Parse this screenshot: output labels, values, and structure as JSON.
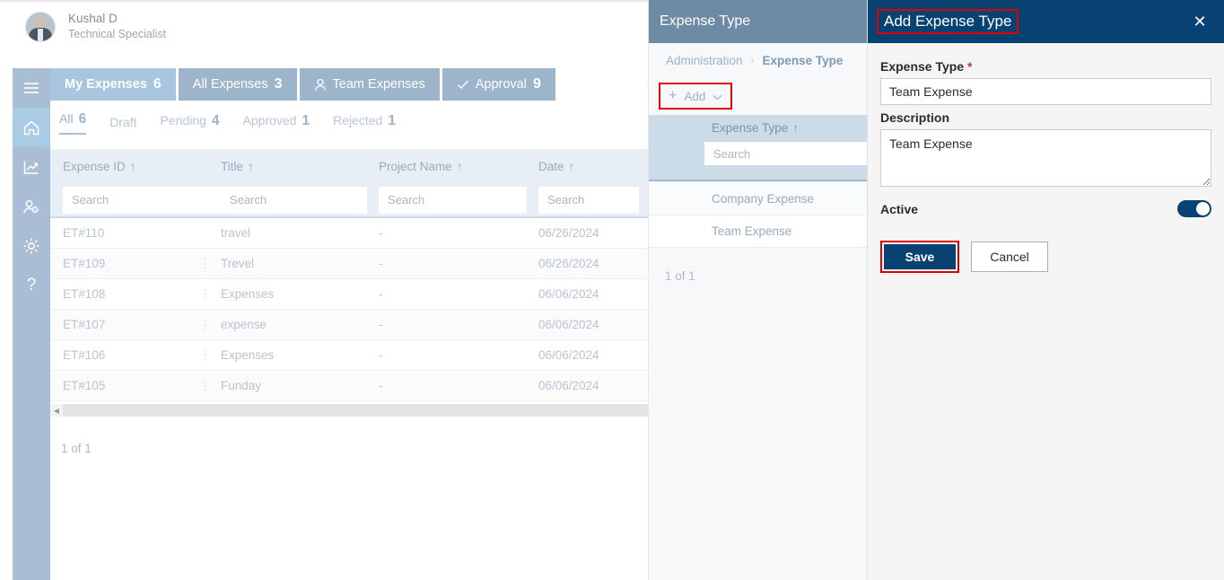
{
  "user": {
    "name": "Kushal D",
    "role": "Technical Specialist"
  },
  "rail": {
    "items": [
      {
        "name": "menu",
        "icon": "hamburger-icon"
      },
      {
        "name": "home",
        "icon": "home-icon"
      },
      {
        "name": "analytics",
        "icon": "chart-line-icon"
      },
      {
        "name": "user-settings",
        "icon": "user-gear-icon"
      },
      {
        "name": "settings",
        "icon": "gear-icon"
      },
      {
        "name": "help",
        "icon": "question-mark-icon"
      }
    ]
  },
  "tabs": [
    {
      "label": "My Expenses",
      "count": "6",
      "icon": "",
      "active": true
    },
    {
      "label": "All Expenses",
      "count": "3",
      "icon": "",
      "active": false
    },
    {
      "label": "Team Expenses",
      "count": "",
      "icon": "person-icon",
      "active": false
    },
    {
      "label": "Approval",
      "count": "9",
      "icon": "check-icon",
      "active": false
    }
  ],
  "subtabs": [
    {
      "label": "All",
      "count": "6",
      "active": true
    },
    {
      "label": "Draft",
      "count": "",
      "active": false
    },
    {
      "label": "Pending",
      "count": "4",
      "active": false
    },
    {
      "label": "Approved",
      "count": "1",
      "active": false
    },
    {
      "label": "Rejected",
      "count": "1",
      "active": false
    }
  ],
  "table": {
    "headers": [
      "Expense ID",
      "Title",
      "Project Name",
      "Date"
    ],
    "sort_glyph": "↑",
    "search_placeholder": "Search",
    "search_values": [
      "",
      "",
      "",
      ""
    ],
    "rows": [
      {
        "id": "ET#110",
        "kebab": "",
        "title": "travel",
        "project": "-",
        "date": "06/26/2024"
      },
      {
        "id": "ET#109",
        "kebab": "⋮",
        "title": "Trevel",
        "project": "-",
        "date": "06/26/2024"
      },
      {
        "id": "ET#108",
        "kebab": "⋮",
        "title": "Expenses",
        "project": "-",
        "date": "06/06/2024"
      },
      {
        "id": "ET#107",
        "kebab": "⋮",
        "title": "expense",
        "project": "-",
        "date": "06/06/2024"
      },
      {
        "id": "ET#106",
        "kebab": "⋮",
        "title": "Expenses",
        "project": "-",
        "date": "06/06/2024"
      },
      {
        "id": "ET#105",
        "kebab": "⋮",
        "title": "Funday",
        "project": "-",
        "date": "06/06/2024"
      }
    ],
    "pager": "1 of 1"
  },
  "mid_panel": {
    "header_title": "Expense Type",
    "breadcrumb": {
      "parent": "Administration",
      "separator": "›",
      "current": "Expense Type"
    },
    "add_button": {
      "plus": "+",
      "label": "Add",
      "chevron": "⌄"
    },
    "list_header": "Expense Type",
    "list_sort_glyph": "↑",
    "search_placeholder": "Search",
    "search_value": "",
    "items": [
      "Company Expense",
      "Team Expense"
    ],
    "pager": "1 of 1"
  },
  "dialog": {
    "title": "Add Expense Type",
    "close_glyph": "✕",
    "expense_type_label": "Expense Type",
    "required_mark": "*",
    "expense_type_value": "Team Expense",
    "expense_type_placeholder": "",
    "description_label": "Description",
    "description_value": "Team Expense",
    "description_placeholder": "",
    "active_label": "Active",
    "active_on": true,
    "save_label": "Save",
    "cancel_label": "Cancel"
  },
  "colors": {
    "navy": "#084273",
    "highlight_red": "#e00000",
    "panel_header_blue": "#6e8ba6",
    "rail_blue": "#a9bdd4",
    "tab_blue": "#9db5ca",
    "tab_active_blue": "#a8c6de"
  }
}
